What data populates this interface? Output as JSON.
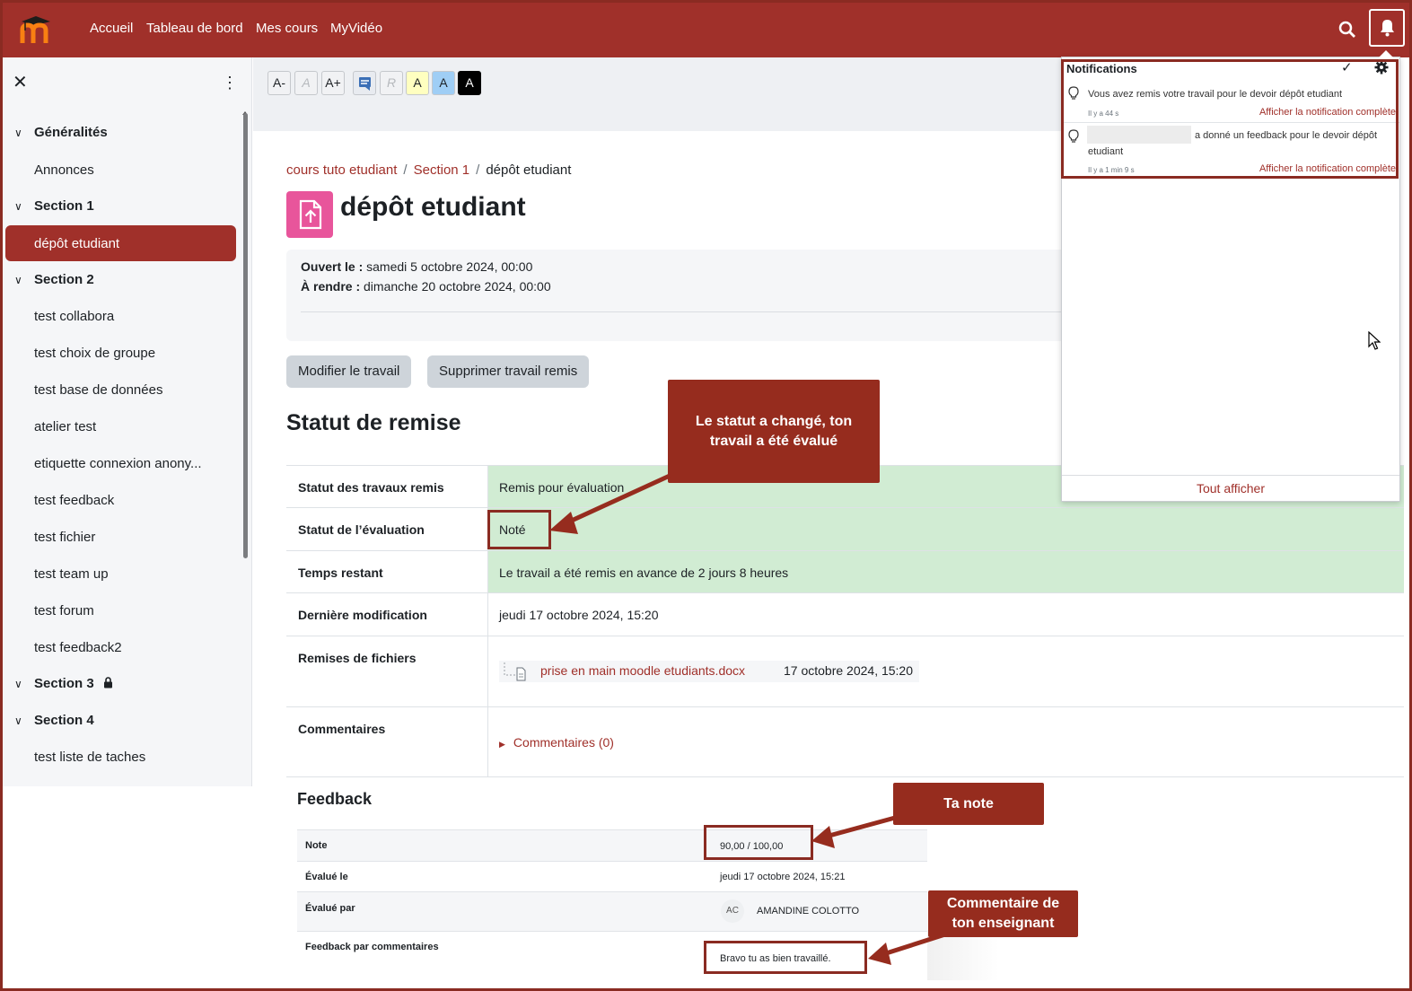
{
  "navbar": {
    "links": [
      "Accueil",
      "Tableau de bord",
      "Mes cours",
      "MyVidéo"
    ],
    "search_icon": "search-icon",
    "bell_icon": "bell-icon",
    "brand_color": "#a0302a"
  },
  "drawer": {
    "items": [
      {
        "type": "section",
        "label": "Généralités"
      },
      {
        "type": "item",
        "label": "Annonces"
      },
      {
        "type": "section",
        "label": "Section 1"
      },
      {
        "type": "item",
        "label": "dépôt etudiant",
        "active": true
      },
      {
        "type": "section",
        "label": "Section 2"
      },
      {
        "type": "item",
        "label": "test collabora"
      },
      {
        "type": "item",
        "label": "test choix de groupe"
      },
      {
        "type": "item",
        "label": "test base de données"
      },
      {
        "type": "item",
        "label": "atelier test"
      },
      {
        "type": "item",
        "label": "etiquette connexion anony..."
      },
      {
        "type": "item",
        "label": "test feedback"
      },
      {
        "type": "item",
        "label": "test fichier"
      },
      {
        "type": "item",
        "label": "test team up"
      },
      {
        "type": "item",
        "label": "test forum"
      },
      {
        "type": "item",
        "label": "test feedback2"
      },
      {
        "type": "section",
        "label": "Section 3",
        "locked": true
      },
      {
        "type": "section",
        "label": "Section 4"
      },
      {
        "type": "item",
        "label": "test liste de taches"
      }
    ]
  },
  "a11y": [
    "A-",
    "A",
    "A+",
    "",
    "R",
    "A",
    "A",
    "A"
  ],
  "breadcrumb": [
    "cours tuto etudiant",
    "Section 1",
    "dépôt etudiant"
  ],
  "page_title": "dépôt etudiant",
  "dates": {
    "opened_label": "Ouvert le :",
    "opened_value": "samedi 5 octobre 2024, 00:00",
    "due_label": "À rendre :",
    "due_value": "dimanche 20 octobre 2024, 00:00"
  },
  "buttons": {
    "edit": "Modifier le travail",
    "delete": "Supprimer travail remis"
  },
  "status": {
    "heading": "Statut de remise",
    "rows": [
      {
        "label": "Statut des travaux remis",
        "value": "Remis pour évaluation"
      },
      {
        "label": "Statut de l’évaluation",
        "value": "Noté"
      },
      {
        "label": "Temps restant",
        "value": "Le travail a été remis en avance de 2 jours 8 heures"
      },
      {
        "label": "Dernière modification",
        "value": "jeudi 17 octobre 2024, 15:20"
      },
      {
        "label": "Remises de fichiers",
        "file_name": "prise en main moodle etudiants.docx",
        "file_date": "17 octobre 2024, 15:20"
      },
      {
        "label": "Commentaires",
        "value": "Commentaires (0)"
      }
    ]
  },
  "feedback": {
    "title": "Feedback",
    "rows": [
      {
        "label": "Note",
        "value": "90,00 / 100,00"
      },
      {
        "label": "Évalué le",
        "value": "jeudi 17 octobre 2024, 15:21"
      },
      {
        "label": "Évalué par",
        "initials": "AC",
        "value": "AMANDINE COLOTTO"
      },
      {
        "label": "Feedback par commentaires",
        "value": "Bravo tu as bien travaillé."
      }
    ]
  },
  "callouts": {
    "status": "Le statut a changé, ton travail a été évalué",
    "grade": "Ta note",
    "comment": "Commentaire de ton enseignant"
  },
  "notifications": {
    "title": "Notifications",
    "items": [
      {
        "text": "Vous avez remis votre travail pour le devoir dépôt etudiant",
        "time": "Il y a 44 s",
        "link": "Afficher la notification complète"
      },
      {
        "text": "a donné un feedback pour le devoir dépôt",
        "text2": "etudiant",
        "time": "Il y a 1 min 9 s",
        "link": "Afficher la notification complète"
      }
    ],
    "show_all": "Tout afficher"
  }
}
